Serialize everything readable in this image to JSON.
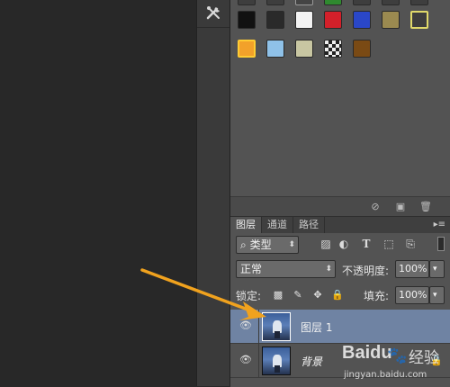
{
  "styles_panel": {
    "swatches_row1": [
      {
        "name": "black-style",
        "color": "#111111"
      },
      {
        "name": "black-bevel-style",
        "color": "#2a2a2a"
      },
      {
        "name": "white-frame-style",
        "color": "#f3f3f3"
      },
      {
        "name": "red-style",
        "color": "#d3202a"
      },
      {
        "name": "blue-style",
        "color": "#2a47c8"
      },
      {
        "name": "gold-texture-style",
        "color": "#9b8a50"
      },
      {
        "name": "yellow-outline-style",
        "color": "#3e3e3e"
      }
    ],
    "swatches_row2": [
      {
        "name": "orange-glow-style",
        "color": "#f2a12a"
      },
      {
        "name": "light-blue-style",
        "color": "#8fc1e8"
      },
      {
        "name": "beige-style",
        "color": "#c8c6a2"
      },
      {
        "name": "checker-style",
        "color": "#dddddd"
      },
      {
        "name": "brown-wood-style",
        "color": "#7a4a14"
      }
    ]
  },
  "layers_panel": {
    "tabs": [
      "图层",
      "通道",
      "路径"
    ],
    "filter_select": "类型",
    "blend_mode": "正常",
    "opacity_label": "不透明度:",
    "opacity_value": "100%",
    "lock_label": "锁定:",
    "fill_label": "填充:",
    "fill_value": "100%",
    "layers": [
      {
        "name": "图层 1",
        "selected": true
      },
      {
        "name": "背景",
        "selected": false
      }
    ]
  },
  "watermark": {
    "brand": "Baidu",
    "cn": "经验",
    "url": "jingyan.baidu.com"
  },
  "colors": {
    "accent_arrow": "#f0a21e",
    "selected_layer": "#6f83a3",
    "panel": "#535353"
  }
}
